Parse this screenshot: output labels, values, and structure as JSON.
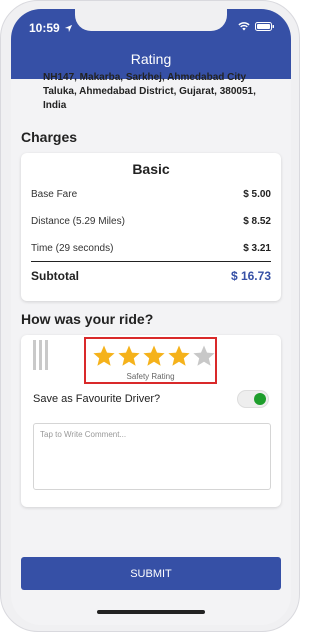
{
  "status_bar": {
    "time": "10:59"
  },
  "header": {
    "title": "Rating"
  },
  "address": "NH147, Makarba, Sarkhej, Ahmedabad City Taluka, Ahmedabad District, Gujarat, 380051, India",
  "charges": {
    "section_title": "Charges",
    "card_title": "Basic",
    "rows": [
      {
        "label": "Base Fare",
        "value": "$ 5.00"
      },
      {
        "label": "Distance (5.29 Miles)",
        "value": "$ 8.52"
      },
      {
        "label": "Time (29 seconds)",
        "value": "$ 3.21"
      }
    ],
    "subtotal_label": "Subtotal",
    "subtotal_value": "$ 16.73"
  },
  "ride": {
    "section_title": "How was your ride?",
    "rating": {
      "value": 4,
      "max": 5,
      "label": "Safety Rating"
    },
    "favourite": {
      "label": "Save as Favourite Driver?",
      "checked": true
    },
    "comment_placeholder": "Tap to Write Comment..."
  },
  "submit_label": "SUBMIT",
  "colors": {
    "primary": "#3650a6",
    "star_filled": "#f5b21b",
    "star_empty": "#c8c8c8",
    "toggle_on": "#1e9e2c",
    "highlight_border": "#d9292a"
  }
}
